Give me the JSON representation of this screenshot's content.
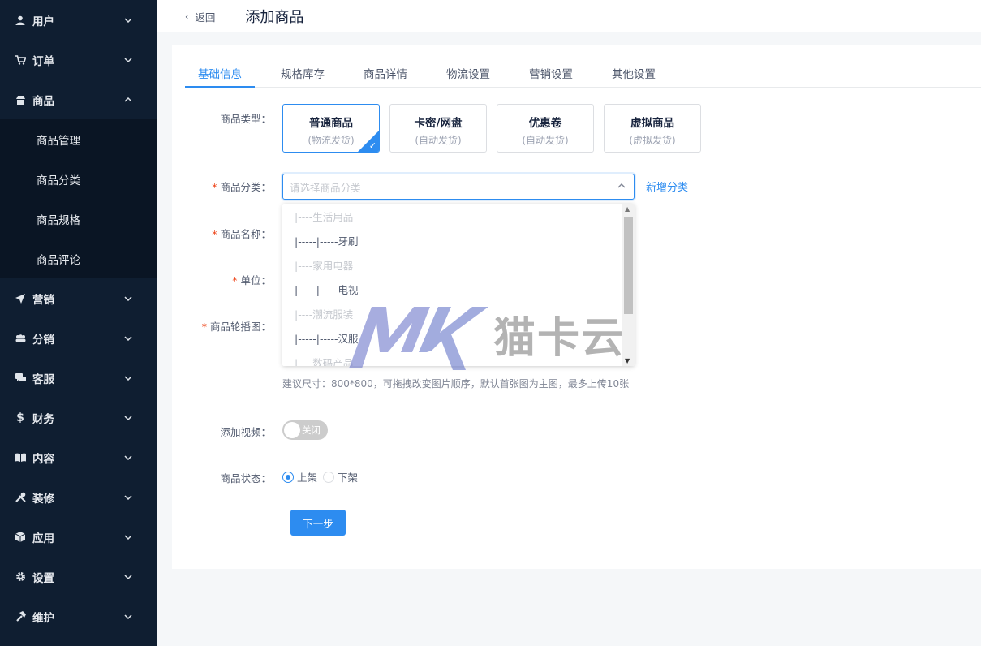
{
  "sidebar": {
    "items": [
      {
        "label": "用户",
        "icon": "user-icon",
        "expanded": false
      },
      {
        "label": "订单",
        "icon": "cart-icon",
        "expanded": false
      },
      {
        "label": "商品",
        "icon": "shop-icon",
        "expanded": true
      },
      {
        "label": "营销",
        "icon": "send-icon",
        "expanded": false
      },
      {
        "label": "分销",
        "icon": "team-icon",
        "expanded": false
      },
      {
        "label": "客服",
        "icon": "chat-icon",
        "expanded": false
      },
      {
        "label": "财务",
        "icon": "dollar-icon",
        "expanded": false
      },
      {
        "label": "内容",
        "icon": "book-icon",
        "expanded": false
      },
      {
        "label": "装修",
        "icon": "tools-icon",
        "expanded": false
      },
      {
        "label": "应用",
        "icon": "cube-icon",
        "expanded": false
      },
      {
        "label": "设置",
        "icon": "gear-icon",
        "expanded": false
      },
      {
        "label": "维护",
        "icon": "hammer-icon",
        "expanded": false
      }
    ],
    "submenu": [
      "商品管理",
      "商品分类",
      "商品规格",
      "商品评论"
    ]
  },
  "header": {
    "back_label": "返回",
    "title": "添加商品"
  },
  "tabs": [
    "基础信息",
    "规格库存",
    "商品详情",
    "物流设置",
    "营销设置",
    "其他设置"
  ],
  "form": {
    "type_label": "商品类型：",
    "types": [
      {
        "name": "普通商品",
        "sub": "(物流发货)",
        "selected": true
      },
      {
        "name": "卡密/网盘",
        "sub": "(自动发货)",
        "selected": false
      },
      {
        "name": "优惠卷",
        "sub": "(自动发货)",
        "selected": false
      },
      {
        "name": "虚拟商品",
        "sub": "(虚拟发货)",
        "selected": false
      }
    ],
    "category_label": "商品分类：",
    "category_placeholder": "请选择商品分类",
    "add_category": "新增分类",
    "name_label": "商品名称：",
    "unit_label": "单位：",
    "carousel_label": "商品轮播图：",
    "carousel_hint": "建议尺寸：800*800，可拖拽改变图片顺序，默认首张图为主图，最多上传10张",
    "video_label": "添加视频：",
    "video_switch": "关闭",
    "status_label": "商品状态：",
    "status_on": "上架",
    "status_off": "下架",
    "next_button": "下一步",
    "required_mark": "*"
  },
  "dropdown": {
    "options": [
      {
        "label": "|----生活用品",
        "disabled": true
      },
      {
        "label": "|-----|-----牙刷",
        "disabled": false
      },
      {
        "label": "|----家用电器",
        "disabled": true
      },
      {
        "label": "|-----|-----电视",
        "disabled": false
      },
      {
        "label": "|----潮流服装",
        "disabled": true
      },
      {
        "label": "|-----|-----汉服",
        "disabled": false
      },
      {
        "label": "|----数码产品",
        "disabled": true
      }
    ]
  },
  "watermark": {
    "logo": "MK",
    "text": "猫卡云"
  },
  "colors": {
    "primary": "#2d8cf0",
    "sidebar_bg": "#0f1e31",
    "submenu_bg": "#0a1524"
  }
}
